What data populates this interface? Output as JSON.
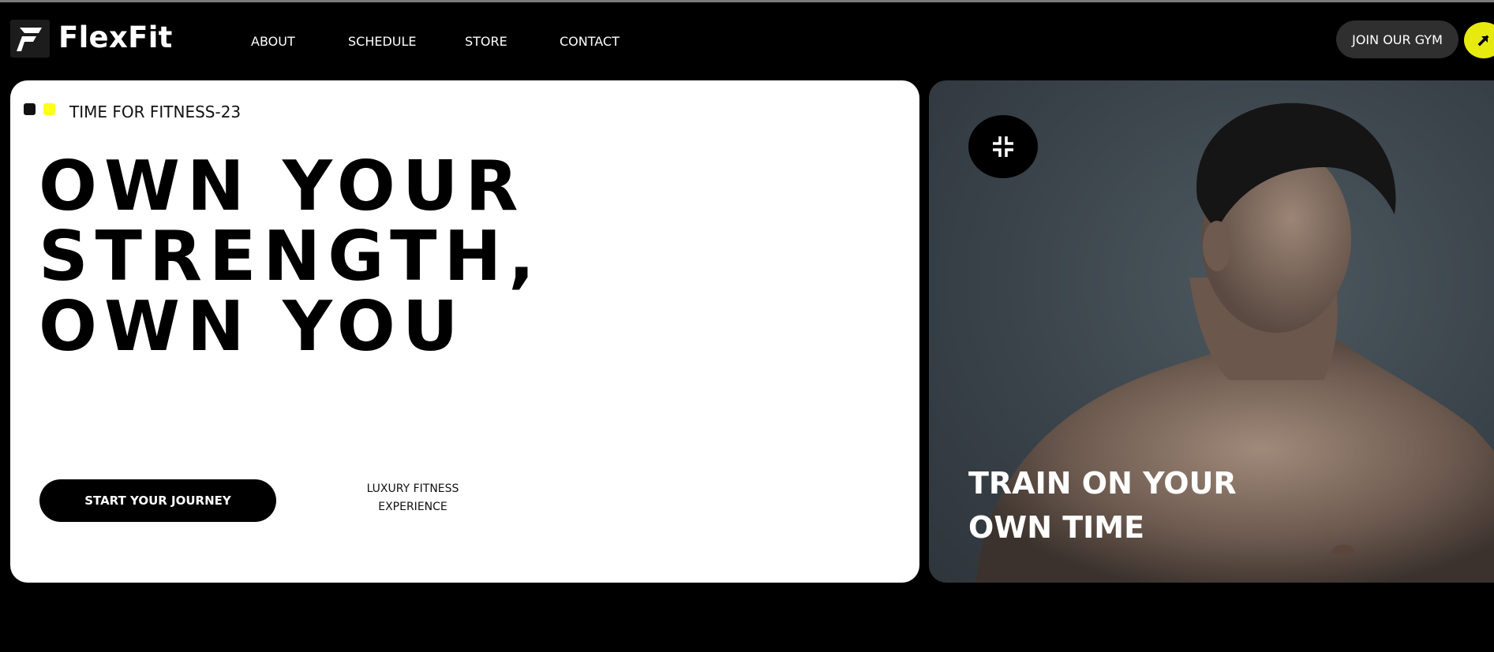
{
  "header": {
    "brand": "FlexFit",
    "nav": [
      {
        "label": "ABOUT"
      },
      {
        "label": "SCHEDULE"
      },
      {
        "label": "STORE"
      },
      {
        "label": "CONTACT"
      }
    ],
    "join_label": "JOIN OUR GYM",
    "arrow_icon": "arrow-up-right-icon",
    "accent_color": "#e6ea0e"
  },
  "hero": {
    "tagline": "TIME FOR FITNESS-23",
    "headline": [
      "OWN YOUR",
      "STRENGTH,",
      "OWN YOU"
    ],
    "cta_label": "START YOUR JOURNEY",
    "feature_line1": "LUXURY FITNESS",
    "feature_line2": "EXPERIENCE"
  },
  "promo": {
    "icon": "collapse-icon",
    "line1": "TRAIN ON YOUR",
    "line2": "OWN TIME"
  }
}
